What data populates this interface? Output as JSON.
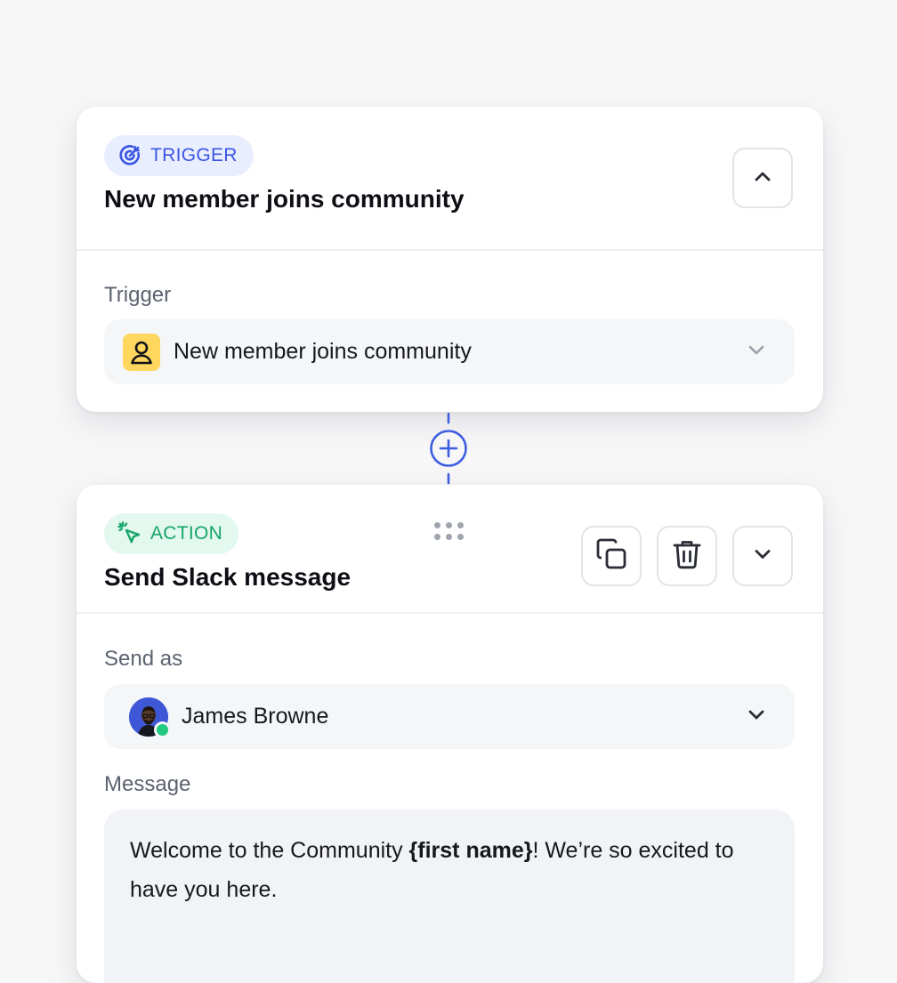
{
  "colors": {
    "accent_blue": "#3a55e0",
    "accent_green": "#17a568",
    "member_icon_yellow": "#ffd75e",
    "online_green": "#22c980"
  },
  "trigger_card": {
    "badge_label": "TRIGGER",
    "badge_icon": "target-icon",
    "title": "New member joins community",
    "collapse_icon": "chevron-up-icon",
    "field_label": "Trigger",
    "select_value": "New member joins community",
    "select_icon": "user-icon",
    "select_chevron": "chevron-down-icon"
  },
  "connector": {
    "icon": "plus-circle-icon"
  },
  "action_card": {
    "badge_label": "ACTION",
    "badge_icon": "cursor-click-icon",
    "title": "Send Slack message",
    "buttons": [
      "copy-icon",
      "trash-icon",
      "chevron-down-icon"
    ],
    "send_as_label": "Send as",
    "send_as_value": "James Browne",
    "send_as_status": "online",
    "message_label": "Message",
    "message": {
      "prefix": "Welcome to the Community ",
      "variable": "{first name}",
      "suffix": "! We’re so excited to have you here."
    }
  }
}
